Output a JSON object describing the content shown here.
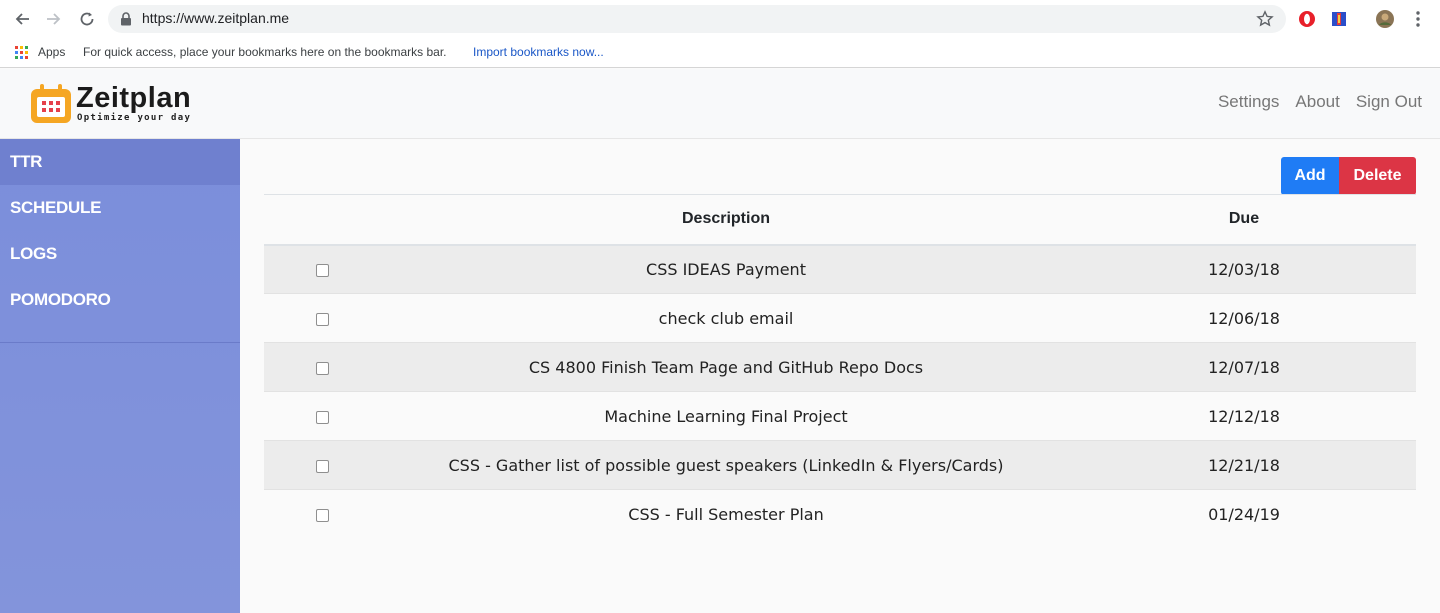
{
  "browser": {
    "url": "https://www.zeitplan.me",
    "bookmarks": {
      "apps_label": "Apps",
      "hint": "For quick access, place your bookmarks here on the bookmarks bar.",
      "import_link": "Import bookmarks now..."
    }
  },
  "header": {
    "logo_title": "Zeitplan",
    "logo_tagline": "Optimize your day",
    "nav": {
      "settings": "Settings",
      "about": "About",
      "sign_out": "Sign Out"
    }
  },
  "sidebar": {
    "items": [
      {
        "label": "TTR",
        "active": true
      },
      {
        "label": "SCHEDULE",
        "active": false
      },
      {
        "label": "LOGS",
        "active": false
      },
      {
        "label": "POMODORO",
        "active": false
      }
    ]
  },
  "toolbar": {
    "add_label": "Add",
    "delete_label": "Delete"
  },
  "table": {
    "columns": [
      "",
      "Description",
      "Due"
    ],
    "rows": [
      {
        "description": "CSS IDEAS Payment",
        "due": "12/03/18",
        "checked": false
      },
      {
        "description": "check club email",
        "due": "12/06/18",
        "checked": false
      },
      {
        "description": "CS 4800 Finish Team Page and GitHub Repo Docs",
        "due": "12/07/18",
        "checked": false
      },
      {
        "description": "Machine Learning Final Project",
        "due": "12/12/18",
        "checked": false
      },
      {
        "description": "CSS - Gather list of possible guest speakers (LinkedIn & Flyers/Cards)",
        "due": "12/21/18",
        "checked": false
      },
      {
        "description": "CSS - Full Semester Plan",
        "due": "01/24/19",
        "checked": false
      }
    ]
  },
  "colors": {
    "sidebar": "#7b8edb",
    "sidebar_active": "#6f80cf",
    "add_button": "#1f7cf5",
    "delete_button": "#dc3545",
    "logo_orange": "#f5a623"
  }
}
